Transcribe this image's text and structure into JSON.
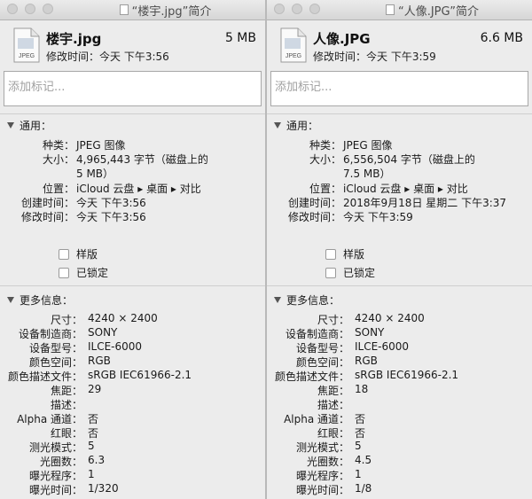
{
  "windows": [
    {
      "title": "“楼宇.jpg”简介",
      "icon_label": "JPEG",
      "file_name": "楼宇.jpg",
      "file_size": "5 MB",
      "modified_summary": "修改时间：今天 下午3:56",
      "tags_placeholder": "添加标记...",
      "general_header": "通用：",
      "general": [
        {
          "label": "种类：",
          "value": "JPEG 图像"
        },
        {
          "label": "大小：",
          "value": "4,965,443 字节（磁盘上的"
        },
        {
          "label": "",
          "value": "5 MB）"
        },
        {
          "label": "位置：",
          "value": "iCloud 云盘 ▸ 桌面 ▸ 对比"
        },
        {
          "label": "创建时间：",
          "value": "今天 下午3:56"
        },
        {
          "label": "修改时间：",
          "value": "今天 下午3:56"
        }
      ],
      "checkboxes": [
        "样版",
        "已锁定"
      ],
      "more_header": "更多信息：",
      "more": [
        {
          "label": "尺寸：",
          "value": "4240 × 2400"
        },
        {
          "label": "设备制造商：",
          "value": "SONY"
        },
        {
          "label": "设备型号：",
          "value": "ILCE-6000"
        },
        {
          "label": "颜色空间：",
          "value": "RGB"
        },
        {
          "label": "颜色描述文件：",
          "value": "sRGB IEC61966-2.1"
        },
        {
          "label": "焦距：",
          "value": "29"
        },
        {
          "label": "描述：",
          "value": ""
        },
        {
          "label": "Alpha 通道：",
          "value": "否"
        },
        {
          "label": "红眼：",
          "value": "否"
        },
        {
          "label": "测光模式：",
          "value": "5"
        },
        {
          "label": "光圈数：",
          "value": "6.3"
        },
        {
          "label": "曝光程序：",
          "value": "1"
        },
        {
          "label": "曝光时间：",
          "value": "1/320"
        }
      ]
    },
    {
      "title": "“人像.JPG”简介",
      "icon_label": "JPEG",
      "file_name": "人像.JPG",
      "file_size": "6.6 MB",
      "modified_summary": "修改时间：今天 下午3:59",
      "tags_placeholder": "添加标记...",
      "general_header": "通用：",
      "general": [
        {
          "label": "种类：",
          "value": "JPEG 图像"
        },
        {
          "label": "大小：",
          "value": "6,556,504 字节（磁盘上的"
        },
        {
          "label": "",
          "value": "7.5 MB）"
        },
        {
          "label": "位置：",
          "value": "iCloud 云盘 ▸ 桌面 ▸ 对比"
        },
        {
          "label": "创建时间：",
          "value": "2018年9月18日 星期二 下午3:37"
        },
        {
          "label": "修改时间：",
          "value": "今天 下午3:59"
        }
      ],
      "checkboxes": [
        "样版",
        "已锁定"
      ],
      "more_header": "更多信息：",
      "more": [
        {
          "label": "尺寸：",
          "value": "4240 × 2400"
        },
        {
          "label": "设备制造商：",
          "value": "SONY"
        },
        {
          "label": "设备型号：",
          "value": "ILCE-6000"
        },
        {
          "label": "颜色空间：",
          "value": "RGB"
        },
        {
          "label": "颜色描述文件：",
          "value": "sRGB IEC61966-2.1"
        },
        {
          "label": "焦距：",
          "value": "18"
        },
        {
          "label": "描述：",
          "value": ""
        },
        {
          "label": "Alpha 通道：",
          "value": "否"
        },
        {
          "label": "红眼：",
          "value": "否"
        },
        {
          "label": "测光模式：",
          "value": "5"
        },
        {
          "label": "光圈数：",
          "value": "4.5"
        },
        {
          "label": "曝光程序：",
          "value": "1"
        },
        {
          "label": "曝光时间：",
          "value": "1/8"
        }
      ]
    }
  ]
}
